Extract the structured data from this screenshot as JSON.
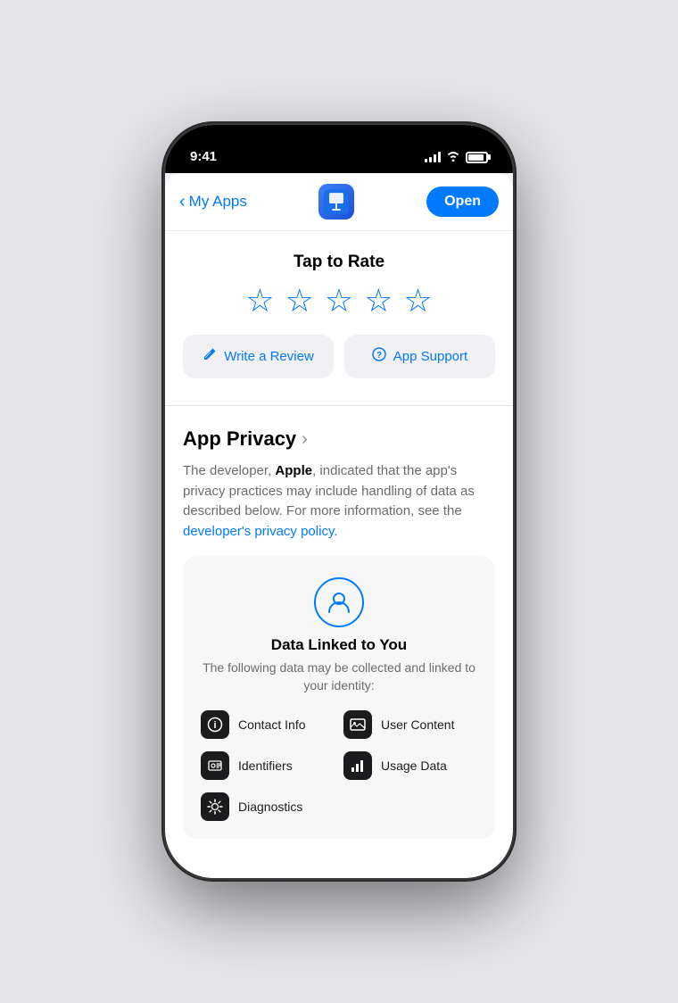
{
  "phone": {
    "time": "9:41",
    "signal_bars": [
      4,
      6,
      8,
      10
    ],
    "battery_level": "90%"
  },
  "nav": {
    "back_label": "My Apps",
    "open_button_label": "Open"
  },
  "rating": {
    "title": "Tap to Rate",
    "stars_count": 5
  },
  "buttons": {
    "write_review_label": "Write a Review",
    "app_support_label": "App Support"
  },
  "privacy": {
    "section_title": "App Privacy",
    "description_part1": "The developer, ",
    "developer_name": "Apple",
    "description_part2": ", indicated that the app's privacy practices may include handling of data as described below. For more information, see the ",
    "privacy_link_text": "developer's privacy policy.",
    "card_icon_alt": "person-icon",
    "card_title": "Data Linked to You",
    "card_subtitle": "The following data may be collected and linked to your identity:",
    "data_items": [
      {
        "id": "contact-info",
        "label": "Contact Info",
        "icon": "ℹ"
      },
      {
        "id": "user-content",
        "label": "User Content",
        "icon": "🖼"
      },
      {
        "id": "identifiers",
        "label": "Identifiers",
        "icon": "👤"
      },
      {
        "id": "usage-data",
        "label": "Usage Data",
        "icon": "📊"
      },
      {
        "id": "diagnostics",
        "label": "Diagnostics",
        "icon": "⚙"
      }
    ]
  }
}
